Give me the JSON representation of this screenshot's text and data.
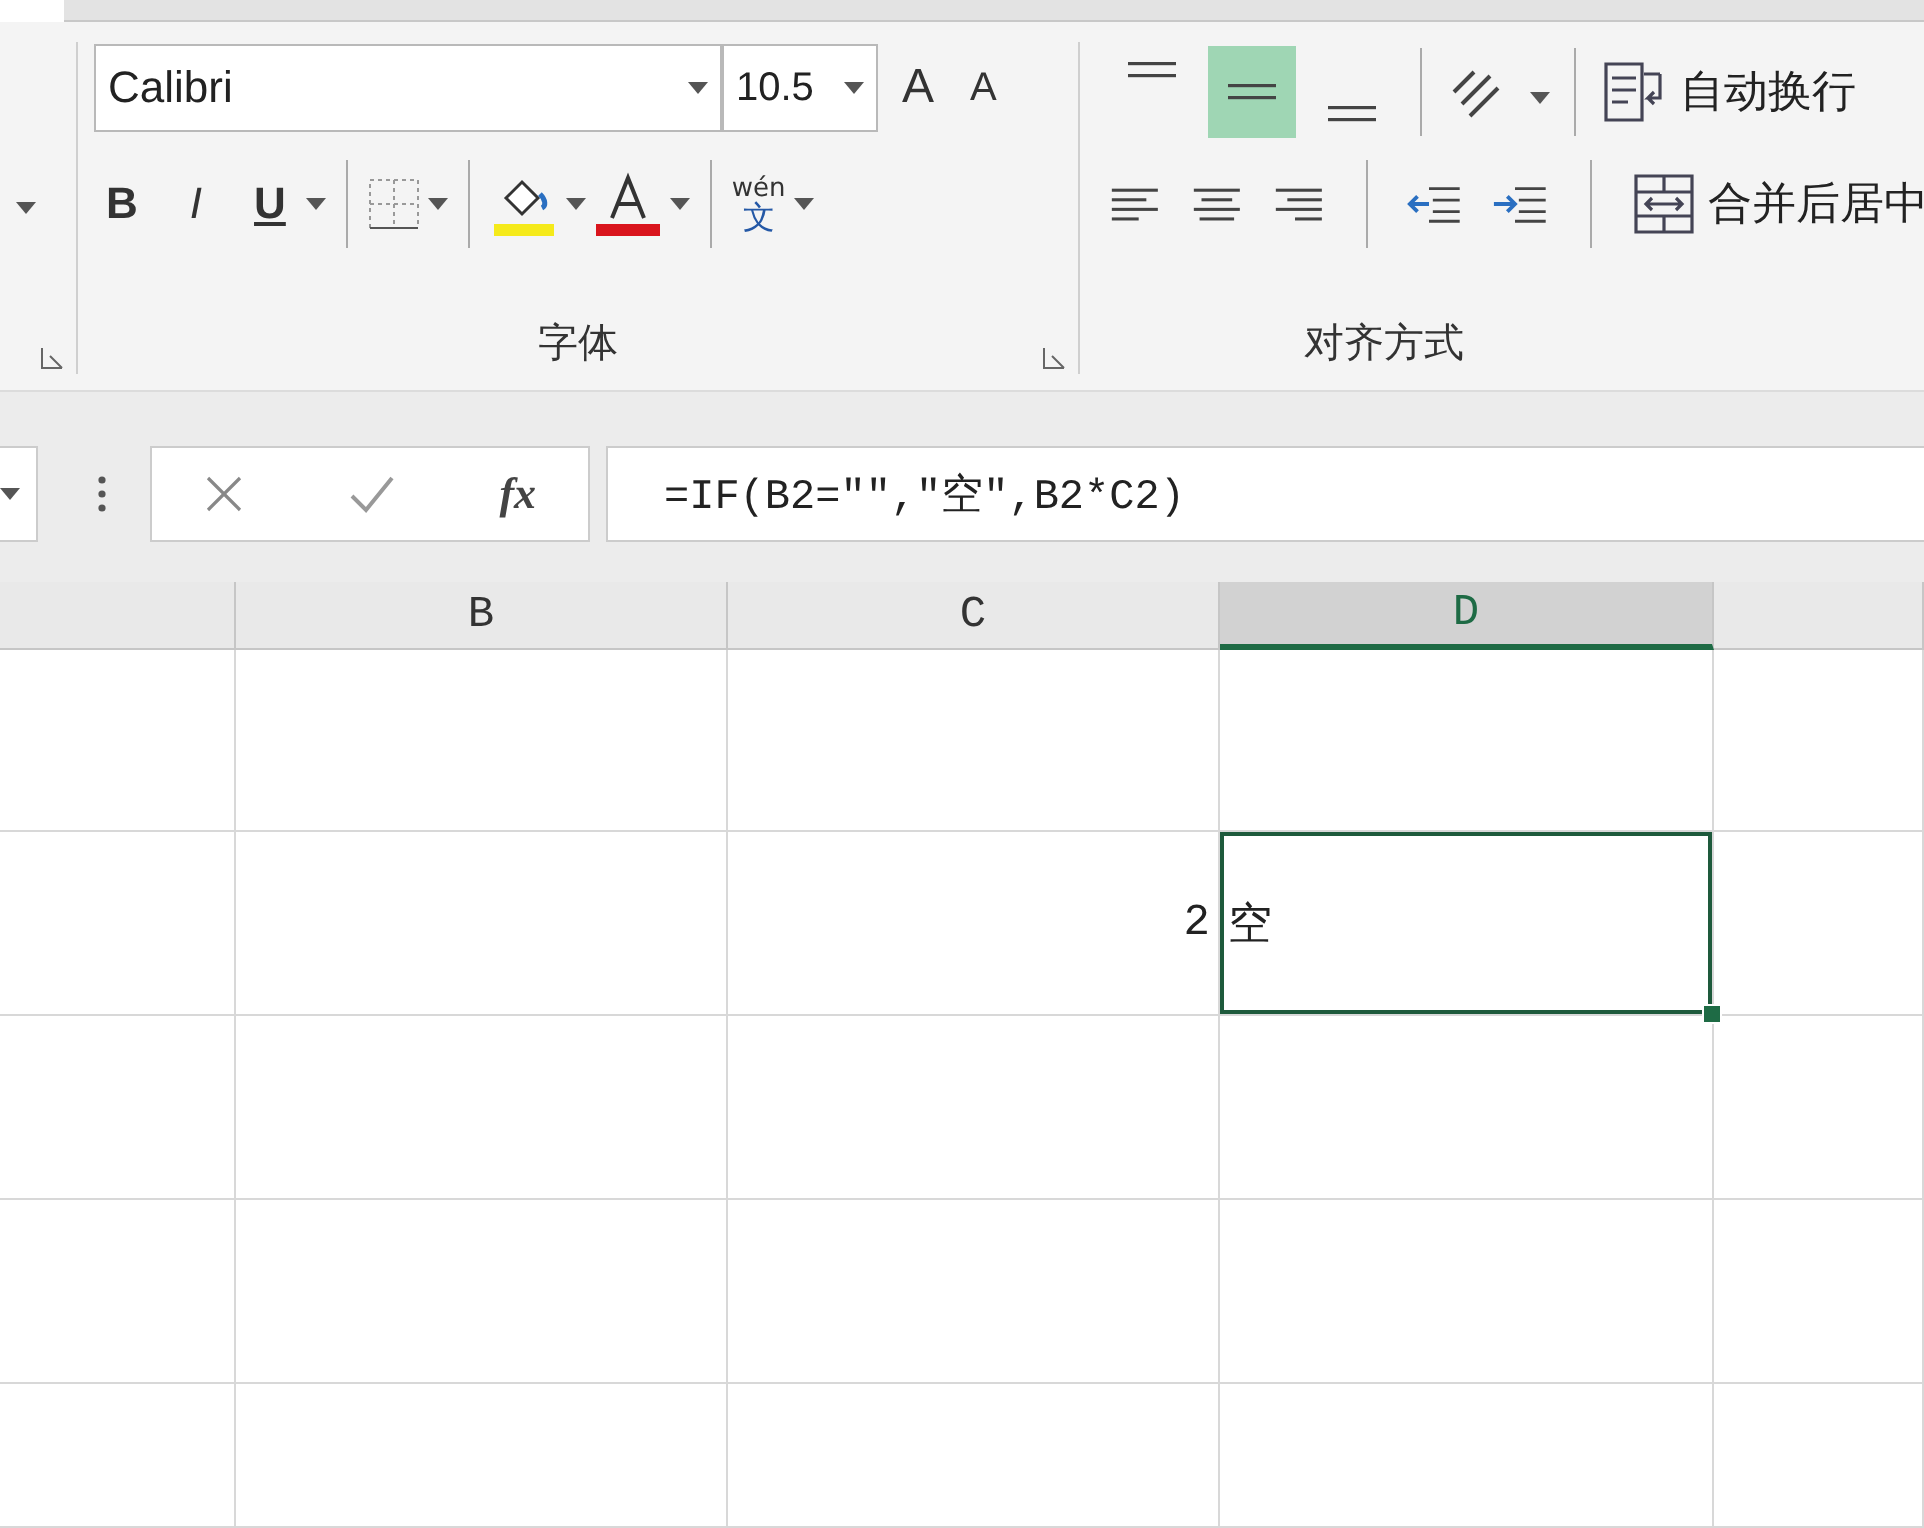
{
  "ribbon": {
    "font_group": {
      "font_name": "Calibri",
      "font_size": "10.5",
      "grow_font": "A",
      "shrink_font": "A",
      "bold": "B",
      "italic": "I",
      "underline": "U",
      "phonetic_top": "wén",
      "phonetic_bottom": "文",
      "label": "字体"
    },
    "alignment_group": {
      "vertical_align": [
        {
          "selected": false
        },
        {
          "selected": true
        },
        {
          "selected": false
        }
      ],
      "wrap_text": "自动换行",
      "merge_center": "合并后居中",
      "label": "对齐方式"
    }
  },
  "formula_bar": {
    "fx": "fx",
    "formula": "=IF(B2=\"\",\"空\",B2*C2)"
  },
  "columns": [
    {
      "selected": false
    },
    {
      "label": "B",
      "selected": false
    },
    {
      "label": "C",
      "selected": false
    },
    {
      "label": "D",
      "selected": true
    },
    {
      "selected": false
    }
  ],
  "rows": [
    {
      "cells": [
        {
          "selected": false
        },
        {
          "selected": false
        },
        {
          "selected": false
        },
        {
          "selected": false
        },
        {
          "selected": false
        }
      ]
    },
    {
      "cells": [
        {
          "selected": false
        },
        {
          "selected": false
        },
        {
          "text": "2",
          "selected": false
        },
        {
          "text": "空",
          "selected": true
        },
        {
          "selected": false
        }
      ]
    },
    {
      "cells": [
        {
          "selected": false
        },
        {
          "selected": false
        },
        {
          "selected": false
        },
        {
          "selected": false
        },
        {
          "selected": false
        }
      ]
    },
    {
      "cells": [
        {
          "selected": false
        },
        {
          "selected": false
        },
        {
          "selected": false
        },
        {
          "selected": false
        },
        {
          "selected": false
        }
      ]
    },
    {
      "cells": [
        {
          "selected": false
        },
        {
          "selected": false
        },
        {
          "selected": false
        },
        {
          "selected": false
        },
        {
          "selected": false
        }
      ]
    }
  ]
}
